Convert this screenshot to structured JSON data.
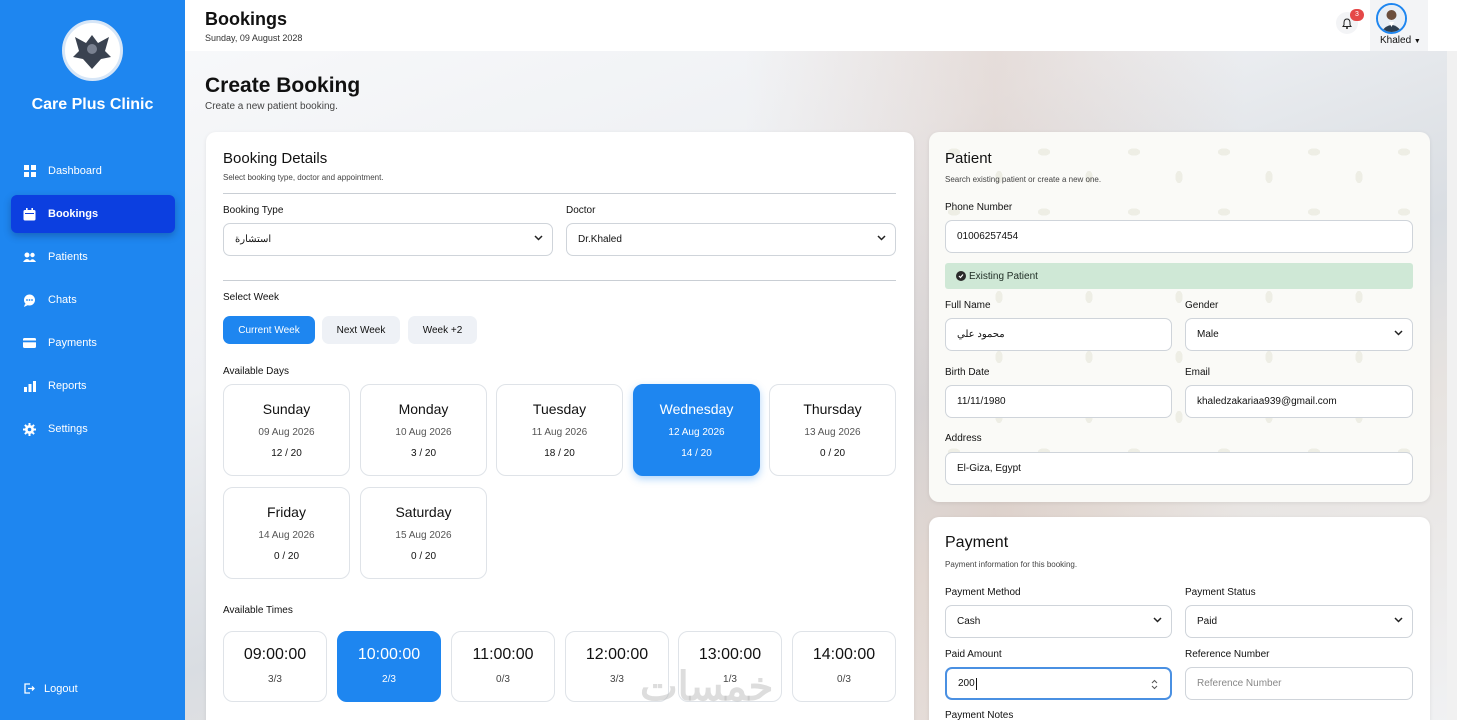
{
  "sidebar": {
    "clinic_name": "Care Plus Clinic",
    "items": [
      {
        "label": "Dashboard",
        "icon": "grid-icon"
      },
      {
        "label": "Bookings",
        "icon": "calendar-icon",
        "active": true
      },
      {
        "label": "Patients",
        "icon": "users-icon"
      },
      {
        "label": "Chats",
        "icon": "chat-icon"
      },
      {
        "label": "Payments",
        "icon": "card-icon"
      },
      {
        "label": "Reports",
        "icon": "bar-chart-icon"
      },
      {
        "label": "Settings",
        "icon": "gear-icon"
      }
    ],
    "logout": "Logout"
  },
  "topbar": {
    "title": "Bookings",
    "date": "Sunday, 09 August 2028",
    "notifications": "3",
    "user": "Khaled"
  },
  "page": {
    "title": "Create Booking",
    "subtitle": "Create a new patient booking."
  },
  "booking": {
    "title": "Booking Details",
    "subtitle": "Select booking type, doctor and appointment.",
    "type_label": "Booking Type",
    "type_value": "استشارة",
    "doctor_label": "Doctor",
    "doctor_value": "Dr.Khaled",
    "week_label": "Select Week",
    "weeks": [
      "Current Week",
      "Next Week",
      "Week +2"
    ],
    "days_label": "Available Days",
    "days": [
      {
        "name": "Sunday",
        "date": "09 Aug 2026",
        "count": "12 / 20"
      },
      {
        "name": "Monday",
        "date": "10 Aug 2026",
        "count": "3 / 20"
      },
      {
        "name": "Tuesday",
        "date": "11 Aug 2026",
        "count": "18 / 20"
      },
      {
        "name": "Wednesday",
        "date": "12 Aug 2026",
        "count": "14 / 20"
      },
      {
        "name": "Thursday",
        "date": "13 Aug 2026",
        "count": "0 / 20"
      },
      {
        "name": "Friday",
        "date": "14 Aug 2026",
        "count": "0 / 20"
      },
      {
        "name": "Saturday",
        "date": "15 Aug 2026",
        "count": "0 / 20"
      }
    ],
    "times_label": "Available Times",
    "times": [
      {
        "time": "09:00:00",
        "cap": "3/3"
      },
      {
        "time": "10:00:00",
        "cap": "2/3"
      },
      {
        "time": "11:00:00",
        "cap": "0/3"
      },
      {
        "time": "12:00:00",
        "cap": "3/3"
      },
      {
        "time": "13:00:00",
        "cap": "1/3"
      },
      {
        "time": "14:00:00",
        "cap": "0/3"
      }
    ]
  },
  "patient": {
    "title": "Patient",
    "subtitle": "Search existing patient or create a new one.",
    "phone_label": "Phone Number",
    "phone_value": "01006257454",
    "status": "Existing Patient",
    "name_label": "Full Name",
    "name_value": "محمود علي",
    "gender_label": "Gender",
    "gender_value": "Male",
    "birth_label": "Birth Date",
    "birth_value": "11/11/1980",
    "email_label": "Email",
    "email_value": "khaledzakariaa939@gmail.com",
    "address_label": "Address",
    "address_value": "El-Giza, Egypt"
  },
  "payment": {
    "title": "Payment",
    "subtitle": "Payment information for this booking.",
    "method_label": "Payment Method",
    "method_value": "Cash",
    "status_label": "Payment Status",
    "status_value": "Paid",
    "amount_label": "Paid Amount",
    "amount_value": "200",
    "ref_label": "Reference Number",
    "ref_placeholder": "Reference Number",
    "notes_label": "Payment Notes"
  },
  "watermark": "خمسات"
}
